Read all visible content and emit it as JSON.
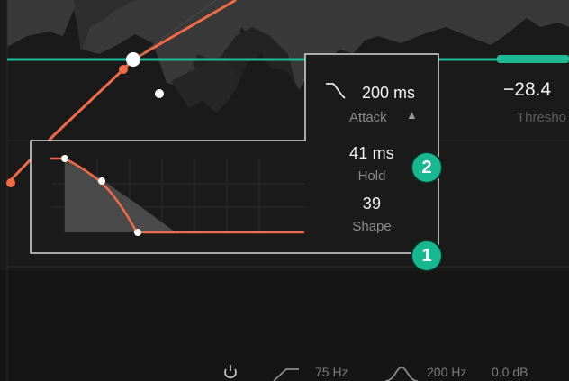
{
  "threshold": {
    "value": "−28.4",
    "label": "Thresho"
  },
  "attack": {
    "value": "200 ms",
    "label": "Attack",
    "arrow": "▲",
    "icon": "attack-curve-icon"
  },
  "hold": {
    "value": "41 ms",
    "label": "Hold"
  },
  "shape": {
    "value": "39",
    "label": "Shape"
  },
  "badges": {
    "one": "1",
    "two": "2"
  },
  "bottom_bar": {
    "power_icon": "power-icon",
    "low_cut_icon": "low-cut-curve-icon",
    "low_cut_freq": "75 Hz",
    "bell_icon": "bell-curve-icon",
    "bell_freq": "200 Hz",
    "bell_gain": "0.0 dB"
  },
  "colors": {
    "accent_teal": "#1fb894",
    "curve_orange": "#f06a47",
    "panel_bg": "#1c1c1c",
    "panel_border": "#d6d6d6"
  }
}
